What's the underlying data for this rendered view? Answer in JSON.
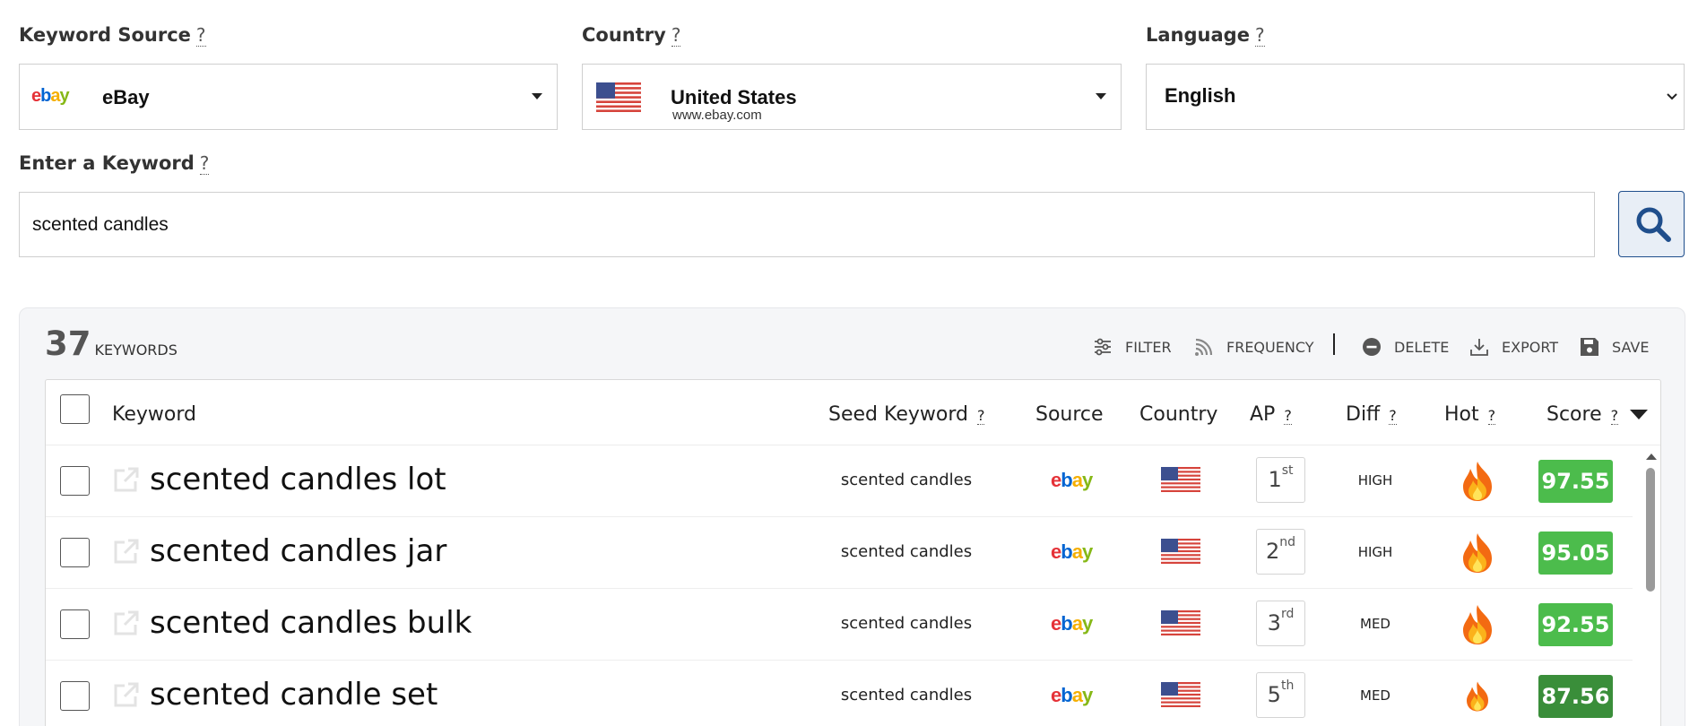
{
  "form": {
    "source": {
      "label": "Keyword Source",
      "help": "?",
      "value": "eBay",
      "icon": "ebay-logo"
    },
    "country": {
      "label": "Country",
      "help": "?",
      "value": "United States",
      "domain": "www.ebay.com",
      "icon": "us-flag"
    },
    "language": {
      "label": "Language",
      "help": "?",
      "value": "English"
    },
    "keyword": {
      "label": "Enter a Keyword",
      "help": "?",
      "value": "scented candles",
      "search_icon": "magnifier-icon"
    }
  },
  "results": {
    "count": "37",
    "count_label": "KEYWORDS",
    "toolbar": {
      "filter": "FILTER",
      "frequency": "FREQUENCY",
      "delete": "DELETE",
      "export": "EXPORT",
      "save": "SAVE"
    },
    "columns": {
      "keyword": "Keyword",
      "seed": "Seed Keyword",
      "seed_help": "?",
      "source": "Source",
      "country": "Country",
      "ap": "AP",
      "ap_help": "?",
      "diff": "Diff",
      "diff_help": "?",
      "hot": "Hot",
      "hot_help": "?",
      "score": "Score",
      "score_help": "?"
    },
    "rows": [
      {
        "keyword": "scented candles lot",
        "seed": "scented candles",
        "ap_num": "1",
        "ap_suffix": "st",
        "diff": "HIGH",
        "score": "97.55",
        "score_color": "#4cbc4c",
        "hot_level": 1.0
      },
      {
        "keyword": "scented candles jar",
        "seed": "scented candles",
        "ap_num": "2",
        "ap_suffix": "nd",
        "diff": "HIGH",
        "score": "95.05",
        "score_color": "#4cbc4c",
        "hot_level": 1.0
      },
      {
        "keyword": "scented candles bulk",
        "seed": "scented candles",
        "ap_num": "3",
        "ap_suffix": "rd",
        "diff": "MED",
        "score": "92.55",
        "score_color": "#4cbc4c",
        "hot_level": 1.0
      },
      {
        "keyword": "scented candle set",
        "seed": "scented candles",
        "ap_num": "5",
        "ap_suffix": "th",
        "diff": "MED",
        "score": "87.56",
        "score_color": "#3a8e3a",
        "hot_level": 0.75
      }
    ]
  }
}
